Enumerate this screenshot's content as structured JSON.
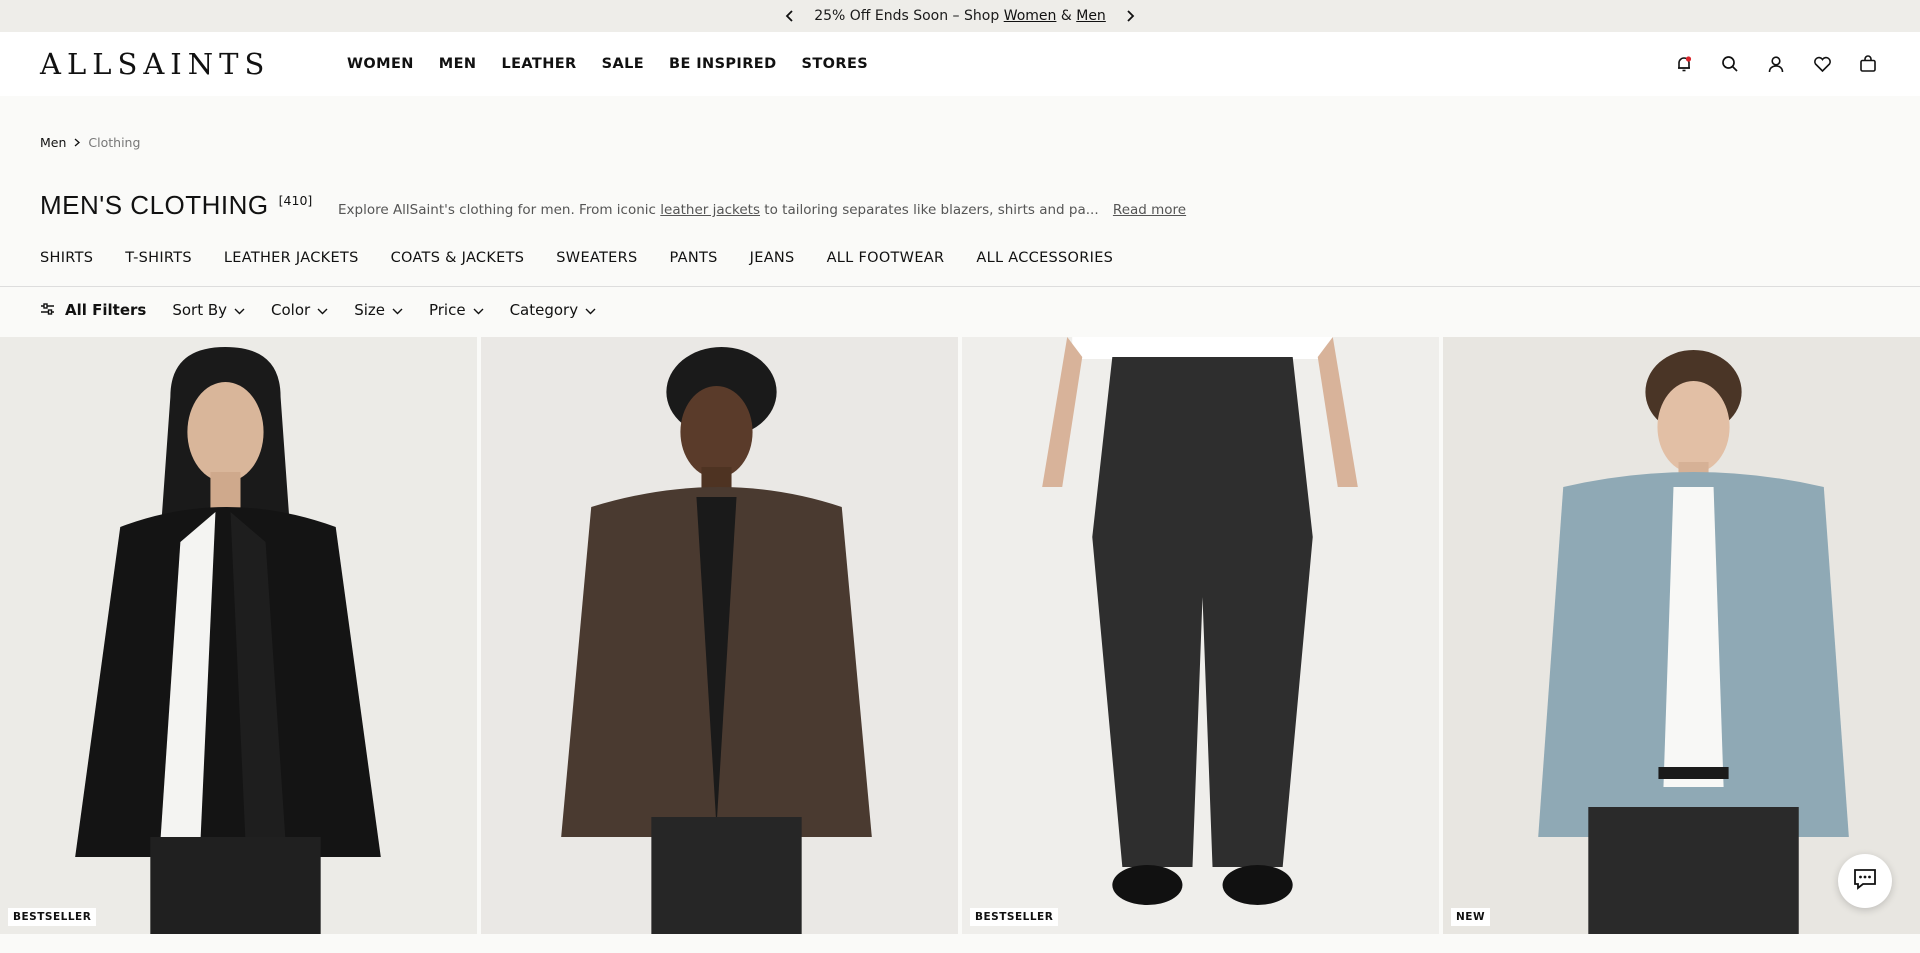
{
  "promo": {
    "text_prefix": "25% Off Ends Soon – Shop ",
    "link_women": "Women",
    "amp": " & ",
    "link_men": "Men"
  },
  "header": {
    "logo": "ALLSAINTS",
    "nav": [
      "WOMEN",
      "MEN",
      "LEATHER",
      "SALE",
      "BE INSPIRED",
      "STORES"
    ],
    "icons": [
      "bell-icon",
      "search-icon",
      "account-icon",
      "heart-icon",
      "bag-icon"
    ]
  },
  "breadcrumb": {
    "home": "Men",
    "current": "Clothing"
  },
  "page": {
    "title": "MEN'S CLOTHING",
    "count": "[410]",
    "desc_prefix": "Explore AllSaint's clothing for men. From iconic ",
    "desc_link": "leather jackets",
    "desc_suffix": " to tailoring separates like blazers, shirts and pa...",
    "read_more": "Read more"
  },
  "categories": [
    "SHIRTS",
    "T-SHIRTS",
    "LEATHER JACKETS",
    "COATS & JACKETS",
    "SWEATERS",
    "PANTS",
    "JEANS",
    "ALL FOOTWEAR",
    "ALL ACCESSORIES"
  ],
  "filters": {
    "all": "All Filters",
    "items": [
      "Sort By",
      "Color",
      "Size",
      "Price",
      "Category"
    ]
  },
  "products": [
    {
      "badge": "BESTSELLER",
      "bg": "#ecebe7"
    },
    {
      "badge": "",
      "bg": "#eae8e5"
    },
    {
      "badge": "BESTSELLER",
      "bg": "#efeeeb"
    },
    {
      "badge": "NEW",
      "bg": "#e8e6e1"
    }
  ]
}
